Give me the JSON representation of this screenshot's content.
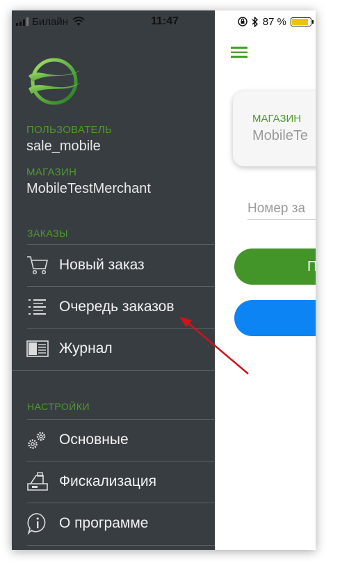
{
  "status_bar": {
    "carrier": "Билайн",
    "time": "11:47",
    "battery": "87 %",
    "battery_level": 0.87
  },
  "drawer": {
    "user_label": "ПОЛЬЗОВАТЕЛЬ",
    "user_value": "sale_mobile",
    "store_label": "МАГАЗИН",
    "store_value": "MobileTestMerchant",
    "orders_section": "ЗАКАЗЫ",
    "orders_items": [
      {
        "label": "Новый заказ",
        "icon": "cart-icon"
      },
      {
        "label": "Очередь заказов",
        "icon": "list-icon"
      },
      {
        "label": "Журнал",
        "icon": "journal-icon"
      }
    ],
    "settings_section": "НАСТРОЙКИ",
    "settings_items": [
      {
        "label": "Основные",
        "icon": "gears-icon"
      },
      {
        "label": "Фискализация",
        "icon": "cash-register-icon"
      },
      {
        "label": "О программе",
        "icon": "info-icon"
      }
    ]
  },
  "main": {
    "card_label": "МАГАЗИН",
    "card_value": "MobileTe",
    "order_placeholder": "Номер за",
    "green_button_label": "П"
  },
  "colors": {
    "drawer_bg": "#383d42",
    "accent_green": "#43952a",
    "accent_blue": "#0d84f4",
    "arrow_red": "#d0131a"
  }
}
